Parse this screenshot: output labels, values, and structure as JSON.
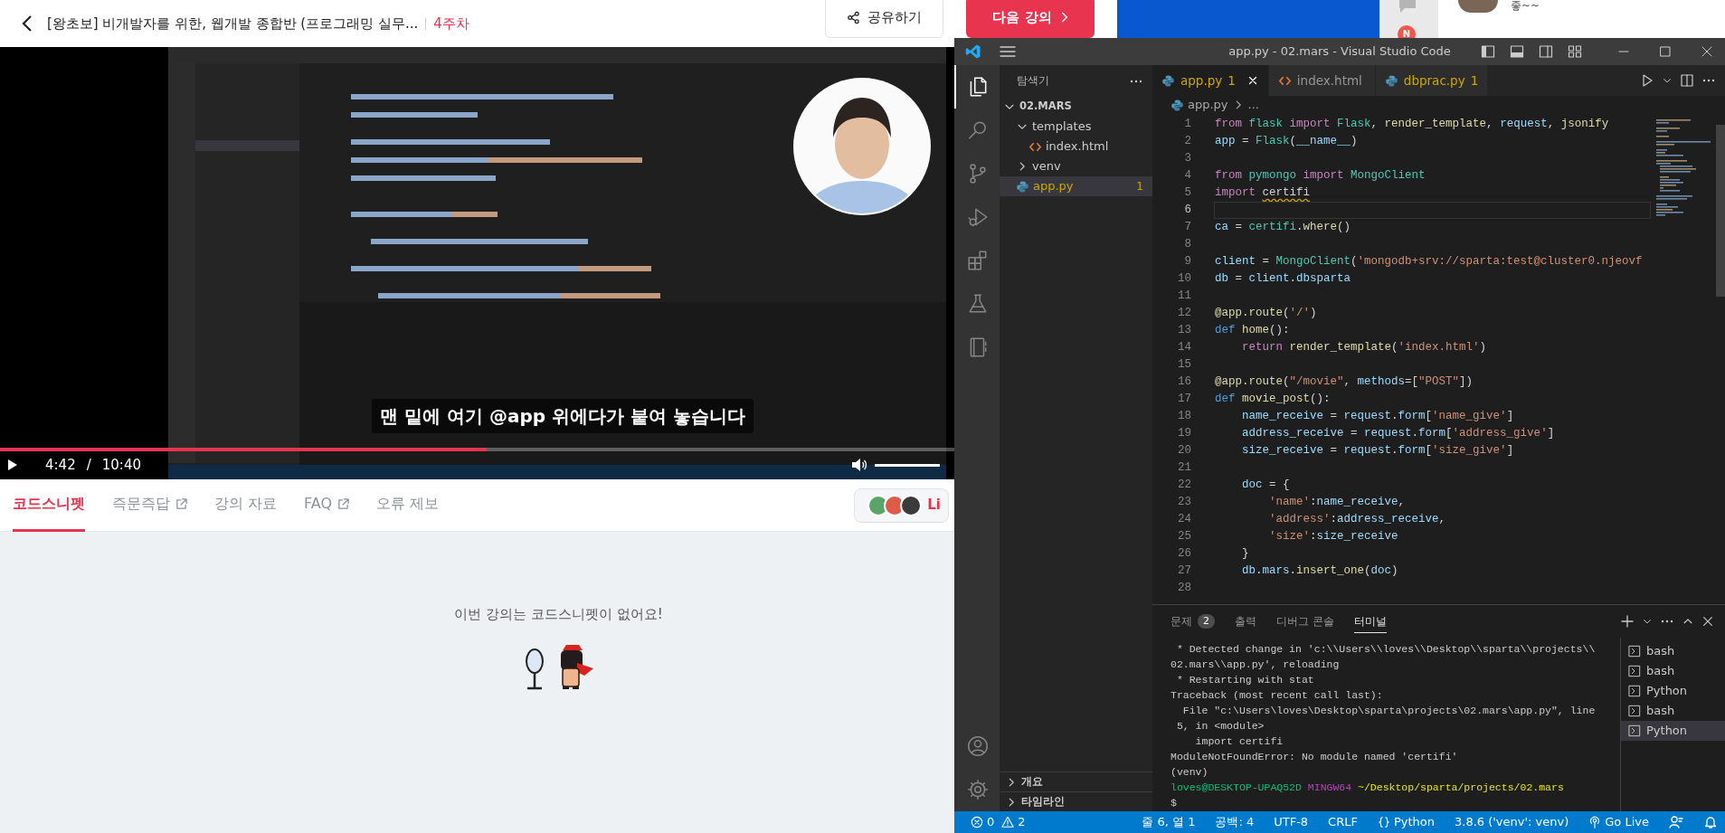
{
  "header": {
    "title": "[왕초보] 비개발자를 위한, 웹개발 종합반 (프로그래밍 실무...",
    "week": "4주차",
    "share_button": "공유하기",
    "next_button": "다음 강의"
  },
  "video": {
    "kind": "picture",
    "caption": "맨 밑에 여기 @app 위에다가 붙여 놓습니다",
    "progress": {
      "level": 0.51
    },
    "current_time": "4:42",
    "separator": "/",
    "duration": "10:40",
    "volume": {
      "level": 1
    }
  },
  "lecture_tabs": [
    {
      "label": "코드스니펫",
      "selected": true,
      "external": false
    },
    {
      "label": "즉문즉답",
      "selected": false,
      "external": true
    },
    {
      "label": "강의 자료",
      "selected": false,
      "external": false
    },
    {
      "label": "FAQ",
      "selected": false,
      "external": true
    },
    {
      "label": "오류 제보",
      "selected": false,
      "external": false
    }
  ],
  "live_button": {
    "label": "Li"
  },
  "empty_message": "이번 강의는 코드스니펫이 없어요!",
  "side_strip": {
    "notification_badge": "N",
    "chat_preview": "좋~~"
  },
  "vscode": {
    "title": "app.py - 02.mars - Visual Studio Code",
    "activity_bar": [
      {
        "kind": "explorer",
        "selected": true
      },
      {
        "kind": "search",
        "selected": false
      },
      {
        "kind": "source-control",
        "selected": false
      },
      {
        "kind": "run",
        "selected": false
      },
      {
        "kind": "extensions",
        "selected": false
      },
      {
        "kind": "testing",
        "selected": false
      },
      {
        "kind": "notebook",
        "selected": false
      }
    ],
    "sidebar": {
      "title": "탐색기",
      "tree": [
        {
          "label": "02.MARS",
          "kind": "folder",
          "expanded": true,
          "selected": false,
          "warning": false,
          "children": [
            {
              "label": "templates",
              "kind": "folder",
              "expanded": true,
              "selected": false,
              "warning": false,
              "children": [
                {
                  "label": "index.html",
                  "kind": "html",
                  "selected": false,
                  "warning": false
                }
              ]
            },
            {
              "label": "venv",
              "kind": "folder",
              "expanded": false,
              "selected": false,
              "warning": false
            },
            {
              "label": "app.py",
              "kind": "python",
              "selected": true,
              "warning": true,
              "badge": "1"
            }
          ]
        }
      ],
      "sections": [
        {
          "label": "개요",
          "expanded": false
        },
        {
          "label": "타임라인",
          "expanded": false
        }
      ]
    },
    "tabs": [
      {
        "label": "app.py",
        "kind": "python",
        "selected": true,
        "warning": true,
        "badge": "1"
      },
      {
        "label": "index.html",
        "kind": "html",
        "selected": false,
        "warning": false
      },
      {
        "label": "dbprac.py",
        "kind": "python",
        "selected": false,
        "warning": true,
        "badge": "1"
      }
    ],
    "breadcrumb": [
      {
        "label": "app.py",
        "kind": "python"
      },
      {
        "label": "...",
        "kind": "more"
      }
    ],
    "code_lines": [
      {
        "number": "1",
        "selected": false,
        "tokens": [
          {
            "text": "from ",
            "kind": "keyword"
          },
          {
            "text": "flask ",
            "kind": "class"
          },
          {
            "text": "import ",
            "kind": "keyword"
          },
          {
            "text": "Flask",
            "kind": "class"
          },
          {
            "text": ", ",
            "kind": "plain"
          },
          {
            "text": "render_template",
            "kind": "function"
          },
          {
            "text": ", ",
            "kind": "plain"
          },
          {
            "text": "request",
            "kind": "variable"
          },
          {
            "text": ", ",
            "kind": "plain"
          },
          {
            "text": "jsonify",
            "kind": "function"
          }
        ]
      },
      {
        "number": "2",
        "selected": false,
        "tokens": [
          {
            "text": "app",
            "kind": "variable"
          },
          {
            "text": " = ",
            "kind": "plain"
          },
          {
            "text": "Flask",
            "kind": "class"
          },
          {
            "text": "(",
            "kind": "plain"
          },
          {
            "text": "__name__",
            "kind": "variable"
          },
          {
            "text": ")",
            "kind": "plain"
          }
        ]
      },
      {
        "number": "3",
        "selected": false
      },
      {
        "number": "4",
        "selected": false,
        "tokens": [
          {
            "text": "from ",
            "kind": "keyword"
          },
          {
            "text": "pymongo ",
            "kind": "class"
          },
          {
            "text": "import ",
            "kind": "keyword"
          },
          {
            "text": "MongoClient",
            "kind": "class"
          }
        ]
      },
      {
        "number": "5",
        "selected": false,
        "tokens": [
          {
            "text": "import ",
            "kind": "keyword"
          },
          {
            "text": "certifi",
            "kind": "unresolved"
          }
        ]
      },
      {
        "number": "6",
        "selected": true
      },
      {
        "number": "7",
        "selected": false,
        "tokens": [
          {
            "text": "ca",
            "kind": "variable"
          },
          {
            "text": " = ",
            "kind": "plain"
          },
          {
            "text": "certifi",
            "kind": "class"
          },
          {
            "text": ".",
            "kind": "plain"
          },
          {
            "text": "where",
            "kind": "function"
          },
          {
            "text": "()",
            "kind": "plain"
          }
        ]
      },
      {
        "number": "8",
        "selected": false
      },
      {
        "number": "9",
        "selected": false,
        "tokens": [
          {
            "text": "client",
            "kind": "variable"
          },
          {
            "text": " = ",
            "kind": "plain"
          },
          {
            "text": "MongoClient",
            "kind": "class"
          },
          {
            "text": "(",
            "kind": "plain"
          },
          {
            "text": "'mongodb+srv://sparta:test@cluster0.njeovf",
            "kind": "string"
          }
        ]
      },
      {
        "number": "10",
        "selected": false,
        "tokens": [
          {
            "text": "db",
            "kind": "variable"
          },
          {
            "text": " = ",
            "kind": "plain"
          },
          {
            "text": "client",
            "kind": "variable"
          },
          {
            "text": ".",
            "kind": "plain"
          },
          {
            "text": "dbsparta",
            "kind": "variable"
          }
        ]
      },
      {
        "number": "11",
        "selected": false
      },
      {
        "number": "12",
        "selected": false,
        "tokens": [
          {
            "text": "@app.route",
            "kind": "function"
          },
          {
            "text": "(",
            "kind": "plain"
          },
          {
            "text": "'/'",
            "kind": "string"
          },
          {
            "text": ")",
            "kind": "plain"
          }
        ]
      },
      {
        "number": "13",
        "selected": false,
        "tokens": [
          {
            "text": "def ",
            "kind": "storage"
          },
          {
            "text": "home",
            "kind": "function"
          },
          {
            "text": "():",
            "kind": "plain"
          }
        ]
      },
      {
        "number": "14",
        "selected": false,
        "tokens": [
          {
            "text": "    return ",
            "kind": "keyword"
          },
          {
            "text": "render_template",
            "kind": "function"
          },
          {
            "text": "(",
            "kind": "plain"
          },
          {
            "text": "'index.html'",
            "kind": "string"
          },
          {
            "text": ")",
            "kind": "plain"
          }
        ]
      },
      {
        "number": "15",
        "selected": false
      },
      {
        "number": "16",
        "selected": false,
        "tokens": [
          {
            "text": "@app.route",
            "kind": "function"
          },
          {
            "text": "(",
            "kind": "plain"
          },
          {
            "text": "\"/movie\"",
            "kind": "string"
          },
          {
            "text": ", ",
            "kind": "plain"
          },
          {
            "text": "methods",
            "kind": "variable"
          },
          {
            "text": "=[",
            "kind": "plain"
          },
          {
            "text": "\"POST\"",
            "kind": "string"
          },
          {
            "text": "])",
            "kind": "plain"
          }
        ]
      },
      {
        "number": "17",
        "selected": false,
        "tokens": [
          {
            "text": "def ",
            "kind": "storage"
          },
          {
            "text": "movie_post",
            "kind": "function"
          },
          {
            "text": "():",
            "kind": "plain"
          }
        ]
      },
      {
        "number": "18",
        "selected": false,
        "tokens": [
          {
            "text": "    name_receive",
            "kind": "variable"
          },
          {
            "text": " = ",
            "kind": "plain"
          },
          {
            "text": "request",
            "kind": "variable"
          },
          {
            "text": ".",
            "kind": "plain"
          },
          {
            "text": "form",
            "kind": "variable"
          },
          {
            "text": "[",
            "kind": "plain"
          },
          {
            "text": "'name_give'",
            "kind": "string"
          },
          {
            "text": "]",
            "kind": "plain"
          }
        ]
      },
      {
        "number": "19",
        "selected": false,
        "tokens": [
          {
            "text": "    address_receive",
            "kind": "variable"
          },
          {
            "text": " = ",
            "kind": "plain"
          },
          {
            "text": "request",
            "kind": "variable"
          },
          {
            "text": ".",
            "kind": "plain"
          },
          {
            "text": "form",
            "kind": "variable"
          },
          {
            "text": "[",
            "kind": "plain"
          },
          {
            "text": "'address_give'",
            "kind": "string"
          },
          {
            "text": "]",
            "kind": "plain"
          }
        ]
      },
      {
        "number": "20",
        "selected": false,
        "tokens": [
          {
            "text": "    size_receive",
            "kind": "variable"
          },
          {
            "text": " = ",
            "kind": "plain"
          },
          {
            "text": "request",
            "kind": "variable"
          },
          {
            "text": ".",
            "kind": "plain"
          },
          {
            "text": "form",
            "kind": "variable"
          },
          {
            "text": "[",
            "kind": "plain"
          },
          {
            "text": "'size_give'",
            "kind": "string"
          },
          {
            "text": "]",
            "kind": "plain"
          }
        ]
      },
      {
        "number": "21",
        "selected": false
      },
      {
        "number": "22",
        "selected": false,
        "tokens": [
          {
            "text": "    doc",
            "kind": "variable"
          },
          {
            "text": " = {",
            "kind": "plain"
          }
        ]
      },
      {
        "number": "23",
        "selected": false,
        "tokens": [
          {
            "text": "        'name'",
            "kind": "string"
          },
          {
            "text": ":",
            "kind": "plain"
          },
          {
            "text": "name_receive",
            "kind": "variable"
          },
          {
            "text": ",",
            "kind": "plain"
          }
        ]
      },
      {
        "number": "24",
        "selected": false,
        "tokens": [
          {
            "text": "        'address'",
            "kind": "string"
          },
          {
            "text": ":",
            "kind": "plain"
          },
          {
            "text": "address_receive",
            "kind": "variable"
          },
          {
            "text": ",",
            "kind": "plain"
          }
        ]
      },
      {
        "number": "25",
        "selected": false,
        "tokens": [
          {
            "text": "        'size'",
            "kind": "string"
          },
          {
            "text": ":",
            "kind": "plain"
          },
          {
            "text": "size_receive",
            "kind": "variable"
          }
        ]
      },
      {
        "number": "26",
        "selected": false,
        "tokens": [
          {
            "text": "    }",
            "kind": "plain"
          }
        ]
      },
      {
        "number": "27",
        "selected": false,
        "tokens": [
          {
            "text": "    db",
            "kind": "variable"
          },
          {
            "text": ".",
            "kind": "plain"
          },
          {
            "text": "mars",
            "kind": "variable"
          },
          {
            "text": ".",
            "kind": "plain"
          },
          {
            "text": "insert_one",
            "kind": "function"
          },
          {
            "text": "(",
            "kind": "plain"
          },
          {
            "text": "doc",
            "kind": "variable"
          },
          {
            "text": ")",
            "kind": "plain"
          }
        ]
      },
      {
        "number": "28",
        "selected": false
      }
    ],
    "panel": {
      "tabs": [
        {
          "label": "문제",
          "selected": false,
          "badge": "2"
        },
        {
          "label": "출력",
          "selected": false
        },
        {
          "label": "디버그 콘솔",
          "selected": false
        },
        {
          "label": "터미널",
          "selected": true
        }
      ],
      "terminal_lines": [
        [
          {
            "text": " * Detected change in 'c:\\\\Users\\\\loves\\\\Desktop\\\\sparta\\\\projects\\\\",
            "kind": "plain"
          }
        ],
        [
          {
            "text": "02.mars\\\\app.py', reloading",
            "kind": "plain"
          }
        ],
        [
          {
            "text": " * Restarting with stat",
            "kind": "plain"
          }
        ],
        [
          {
            "text": "Traceback (most recent call last):",
            "kind": "plain"
          }
        ],
        [
          {
            "text": "  File \"c:\\Users\\loves\\Desktop\\sparta\\projects\\02.mars\\app.py\", line",
            "kind": "plain"
          }
        ],
        [
          {
            "text": " 5, in <module>",
            "kind": "plain"
          }
        ],
        [
          {
            "text": "    import certifi",
            "kind": "plain"
          }
        ],
        [
          {
            "text": "ModuleNotFoundError: No module named 'certifi'",
            "kind": "plain"
          }
        ],
        [
          {
            "text": "(venv)",
            "kind": "plain"
          }
        ],
        [
          {
            "text": "loves@DESKTOP-UPAQ52D ",
            "kind": "user"
          },
          {
            "text": "MINGW64 ",
            "kind": "host"
          },
          {
            "text": "~/Desktop/sparta/projects/02.mars",
            "kind": "path"
          }
        ],
        [
          {
            "text": "$",
            "kind": "plain"
          }
        ]
      ],
      "terminals": [
        {
          "label": "bash",
          "selected": false
        },
        {
          "label": "bash",
          "selected": false
        },
        {
          "label": "Python",
          "selected": false
        },
        {
          "label": "bash",
          "selected": false
        },
        {
          "label": "Python",
          "selected": true
        }
      ]
    },
    "status_bar": {
      "errors": "0",
      "warnings": "2",
      "items": [
        {
          "label": "줄 6, 열 1",
          "kind": "text"
        },
        {
          "label": "공백: 4",
          "kind": "text"
        },
        {
          "label": "UTF-8",
          "kind": "text"
        },
        {
          "label": "CRLF",
          "kind": "text"
        },
        {
          "label": "Python",
          "kind": "language"
        },
        {
          "label": "3.8.6 ('venv': venv)",
          "kind": "text"
        },
        {
          "label": "Go Live",
          "kind": "live"
        }
      ]
    }
  }
}
